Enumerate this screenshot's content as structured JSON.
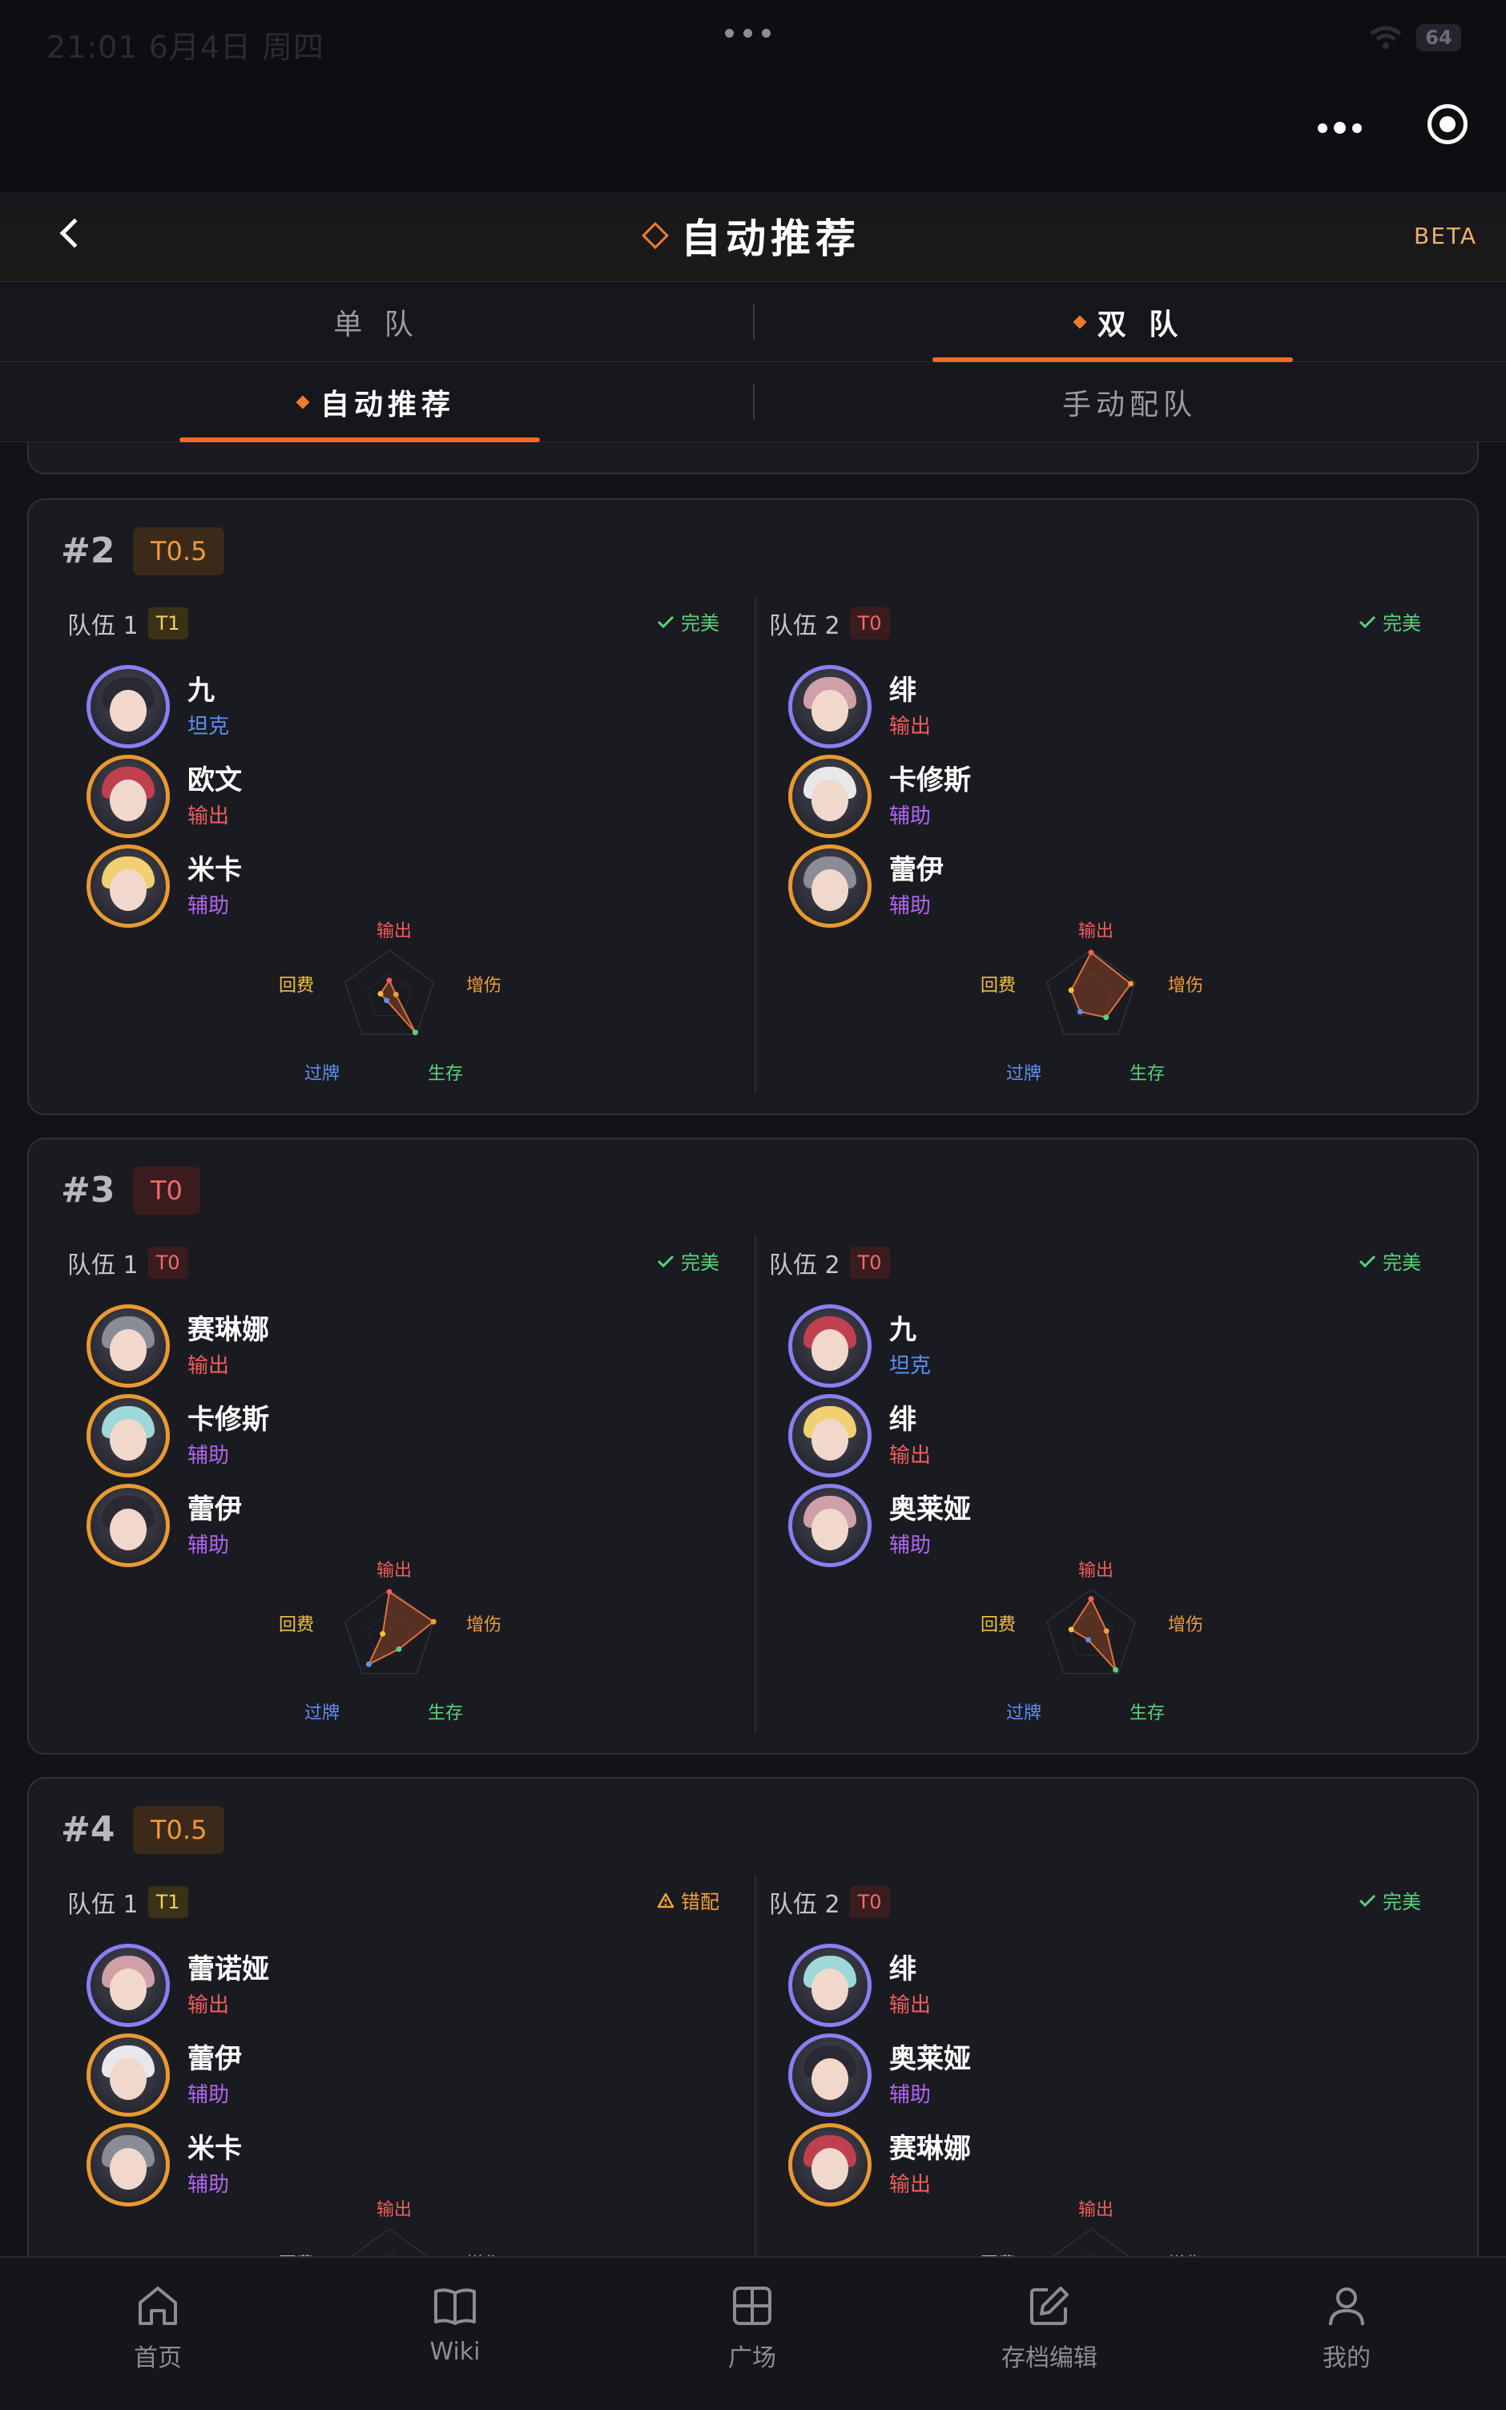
{
  "statusbar": {
    "time": "21:01  6月4日 周四",
    "battery": "64"
  },
  "header": {
    "title": "自动推荐",
    "beta": "BETA"
  },
  "tabs1": [
    {
      "label": "单 队",
      "active": false
    },
    {
      "label": "双 队",
      "active": true
    }
  ],
  "tabs2": [
    {
      "label": "自动推荐",
      "active": true
    },
    {
      "label": "手动配队",
      "active": false
    }
  ],
  "radar_labels": {
    "out": "输出",
    "buff": "增伤",
    "survive": "生存",
    "draw": "过牌",
    "regen": "回费"
  },
  "cards": [
    {
      "rank": "#2",
      "tier": "T0.5",
      "team1": {
        "label": "队伍 1",
        "tier": "T1",
        "status": "完美",
        "members": [
          {
            "name": "九",
            "role": "坦克",
            "role_type": "tank",
            "frame": "purple"
          },
          {
            "name": "欧文",
            "role": "输出",
            "role_type": "dps",
            "frame": "gold"
          },
          {
            "name": "米卡",
            "role": "辅助",
            "role_type": "sup",
            "frame": "gold"
          }
        ],
        "radar": {
          "out": 0.35,
          "buff": 0.15,
          "survive": 0.95,
          "draw": 0.1,
          "regen": 0.2
        }
      },
      "team2": {
        "label": "队伍 2",
        "tier": "T0",
        "status": "完美",
        "members": [
          {
            "name": "绯",
            "role": "输出",
            "role_type": "dps",
            "frame": "purple"
          },
          {
            "name": "卡修斯",
            "role": "辅助",
            "role_type": "sup",
            "frame": "gold"
          },
          {
            "name": "蕾伊",
            "role": "辅助",
            "role_type": "sup",
            "frame": "gold"
          }
        ],
        "radar": {
          "out": 0.95,
          "buff": 0.9,
          "survive": 0.55,
          "draw": 0.4,
          "regen": 0.45
        }
      }
    },
    {
      "rank": "#3",
      "tier": "T0",
      "team1": {
        "label": "队伍 1",
        "tier": "T0",
        "status": "完美",
        "members": [
          {
            "name": "赛琳娜",
            "role": "输出",
            "role_type": "dps",
            "frame": "gold"
          },
          {
            "name": "卡修斯",
            "role": "辅助",
            "role_type": "sup",
            "frame": "gold"
          },
          {
            "name": "蕾伊",
            "role": "辅助",
            "role_type": "sup",
            "frame": "gold"
          }
        ],
        "radar": {
          "out": 0.95,
          "buff": 1.0,
          "survive": 0.35,
          "draw": 0.75,
          "regen": 0.15
        }
      },
      "team2": {
        "label": "队伍 2",
        "tier": "T0",
        "status": "完美",
        "members": [
          {
            "name": "九",
            "role": "坦克",
            "role_type": "tank",
            "frame": "purple"
          },
          {
            "name": "绯",
            "role": "输出",
            "role_type": "dps",
            "frame": "purple"
          },
          {
            "name": "奥莱娅",
            "role": "辅助",
            "role_type": "sup",
            "frame": "purple"
          }
        ],
        "radar": {
          "out": 0.8,
          "buff": 0.35,
          "survive": 0.9,
          "draw": 0.1,
          "regen": 0.45
        }
      }
    },
    {
      "rank": "#4",
      "tier": "T0.5",
      "team1": {
        "label": "队伍 1",
        "tier": "T1",
        "status": "错配",
        "members": [
          {
            "name": "蕾诺娅",
            "role": "输出",
            "role_type": "dps",
            "frame": "purple"
          },
          {
            "name": "蕾伊",
            "role": "辅助",
            "role_type": "sup",
            "frame": "gold"
          },
          {
            "name": "米卡",
            "role": "辅助",
            "role_type": "sup",
            "frame": "gold"
          }
        ]
      },
      "team2": {
        "label": "队伍 2",
        "tier": "T0",
        "status": "完美",
        "members": [
          {
            "name": "绯",
            "role": "输出",
            "role_type": "dps",
            "frame": "purple"
          },
          {
            "name": "奥莱娅",
            "role": "辅助",
            "role_type": "sup",
            "frame": "purple"
          },
          {
            "name": "赛琳娜",
            "role": "输出",
            "role_type": "dps",
            "frame": "gold"
          }
        ]
      }
    }
  ],
  "bottomnav": [
    {
      "label": "首页",
      "icon": "home-icon"
    },
    {
      "label": "Wiki",
      "icon": "book-icon"
    },
    {
      "label": "广场",
      "icon": "grid-icon"
    },
    {
      "label": "存档编辑",
      "icon": "edit-icon"
    },
    {
      "label": "我的",
      "icon": "user-icon"
    }
  ],
  "colors": {
    "accent": "#f06a2a",
    "tank": "#5d8ff2",
    "dps": "#ef5d5d",
    "support": "#b066ef",
    "ok": "#58d27a",
    "warn": "#f0a13b"
  }
}
